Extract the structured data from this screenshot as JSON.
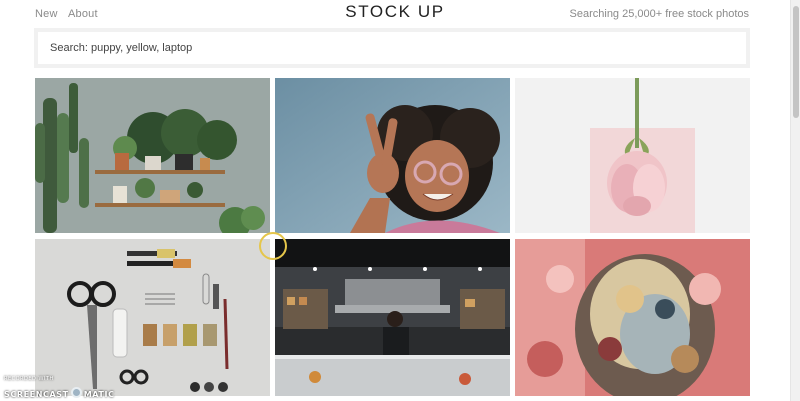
{
  "header": {
    "nav": [
      {
        "label": "New"
      },
      {
        "label": "About"
      }
    ],
    "brand": "STOCK UP",
    "tagline": "Searching 25,000+ free stock photos"
  },
  "search": {
    "placeholder": "Search: puppy, yellow, laptop"
  },
  "photos": [
    {
      "subject": "plants-on-shelves"
    },
    {
      "subject": "woman-peace-sign"
    },
    {
      "subject": "pink-rose-hanging"
    },
    {
      "subject": "tailoring-tools-flatlay"
    },
    {
      "subject": "restaurant-kitchen"
    },
    {
      "subject": "embroidered-fabric"
    }
  ],
  "watermark": {
    "line1": "RECORDED WITH",
    "line2a": "SCREENCAST",
    "line2b": "MATIC"
  }
}
